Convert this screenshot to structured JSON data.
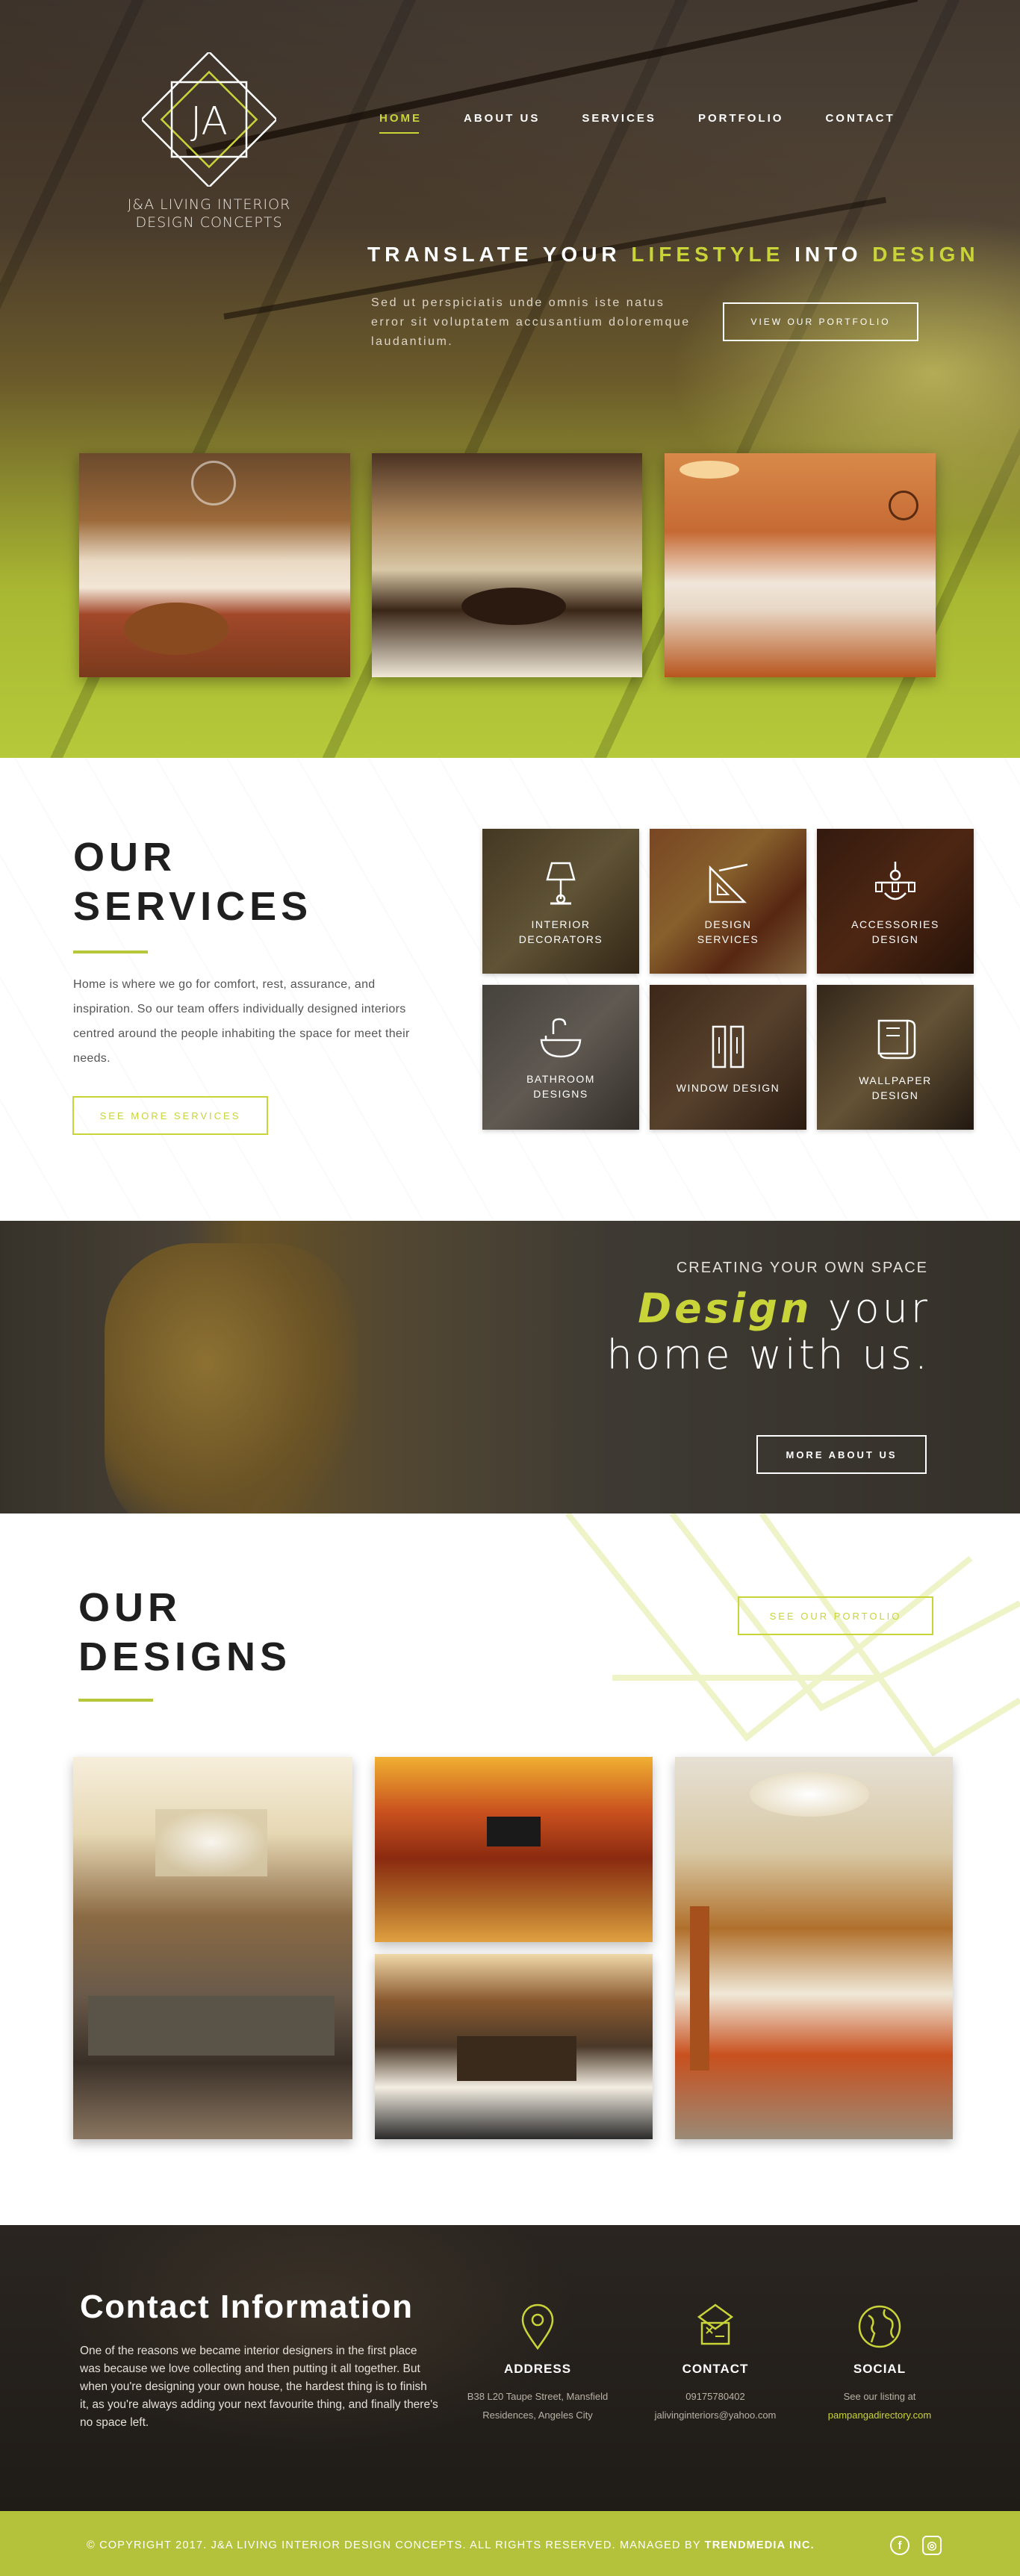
{
  "brand": {
    "monogram": "JA",
    "name_line1": "J&A LIVING INTERIOR",
    "name_line2": "DESIGN CONCEPTS",
    "accent_color": "#c8d438"
  },
  "nav": {
    "items": [
      {
        "label": "HOME",
        "active": true
      },
      {
        "label": "ABOUT US",
        "active": false
      },
      {
        "label": "SERVICES",
        "active": false
      },
      {
        "label": "PORTFOLIO",
        "active": false
      },
      {
        "label": "CONTACT",
        "active": false
      }
    ]
  },
  "hero": {
    "headline_part1": "TRANSLATE YOUR",
    "headline_hl1": "LIFESTYLE",
    "headline_part2": "INTO",
    "headline_hl2": "DESIGN",
    "copy": "Sed ut perspiciatis unde omnis iste natus error sit voluptatem accusantium doloremque laudantium.",
    "cta": "VIEW OUR PORTFOLIO"
  },
  "services": {
    "title_line1": "OUR",
    "title_line2": "SERVICES",
    "description": "Home is where we go for comfort, rest, assurance, and inspiration. So our team offers individually designed interiors centred around the people inhabiting the space for meet their needs.",
    "cta": "SEE MORE SERVICES",
    "tiles": [
      {
        "label": "INTERIOR DECORATORS",
        "icon": "lamp-icon"
      },
      {
        "label": "DESIGN SERVICES",
        "icon": "ruler-triangle-icon"
      },
      {
        "label": "ACCESSORIES DESIGN",
        "icon": "chandelier-icon"
      },
      {
        "label": "BATHROOM DESIGNS",
        "icon": "sink-icon"
      },
      {
        "label": "WINDOW DESIGN",
        "icon": "window-icon"
      },
      {
        "label": "WALLPAPER DESIGN",
        "icon": "wallpaper-roll-icon"
      }
    ]
  },
  "banner": {
    "kicker": "CREATING YOUR OWN SPACE",
    "headline_hl": "Design",
    "headline_rest1": "your",
    "headline_rest2": "home with us.",
    "cta": "MORE ABOUT US"
  },
  "designs": {
    "title_line1": "OUR",
    "title_line2": "DESIGNS",
    "cta": "SEE OUR PORTOLIO"
  },
  "contact": {
    "title": "Contact Information",
    "description": "One of the reasons we became interior designers in the first place was because we love collecting and then putting it all together. But when you're designing your own house, the hardest thing is to finish it, as you're always adding your next favourite thing, and finally there's no space left.",
    "columns": [
      {
        "heading": "ADDRESS",
        "icon": "map-pin-icon",
        "lines": [
          "B38 L20 Taupe Street, Mansfield",
          "Residences, Angeles City"
        ]
      },
      {
        "heading": "CONTACT",
        "icon": "phone-card-icon",
        "lines": [
          "09175780402",
          "jalivinginteriors@yahoo.com"
        ]
      },
      {
        "heading": "SOCIAL",
        "icon": "globe-icon",
        "lines": [
          "See our listing at",
          "pampangadirectory.com"
        ]
      }
    ]
  },
  "footer": {
    "copyright": "© COPYRIGHT 2017.  J&A LIVING INTERIOR DESIGN CONCEPTS. ALL RIGHTS RESERVED. MANAGED BY",
    "managed_by": "TRENDMEDIA INC.",
    "social": [
      {
        "name": "facebook-icon",
        "glyph": "f"
      },
      {
        "name": "instagram-icon",
        "glyph": "◎"
      }
    ]
  }
}
